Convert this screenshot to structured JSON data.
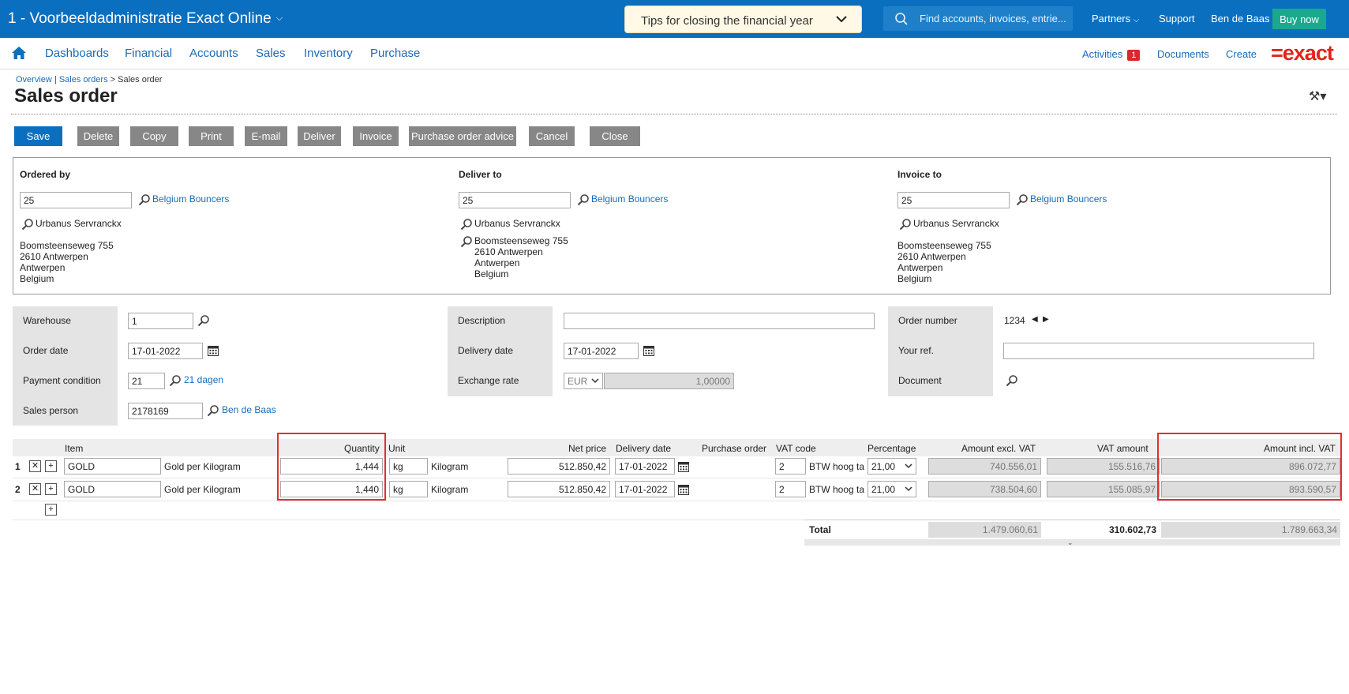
{
  "topbar": {
    "app_title": "1 - Voorbeeldadministratie Exact Online",
    "tips": "Tips for closing the financial year",
    "search_placeholder": "Find accounts, invoices, entrie...",
    "partners": "Partners",
    "support": "Support",
    "user": "Ben de Baas",
    "buy_now": "Buy now"
  },
  "menu": {
    "items": [
      "Dashboards",
      "Financial",
      "Accounts",
      "Sales",
      "Inventory",
      "Purchase"
    ],
    "activities": "Activities",
    "activities_count": "1",
    "documents": "Documents",
    "create": "Create",
    "logo": "=exact"
  },
  "breadcrumb": {
    "overview": "Overview",
    "sep1": "|",
    "sales_orders": "Sales orders",
    "sep2": ">",
    "current": "Sales order"
  },
  "page": {
    "title": "Sales order"
  },
  "toolbar": {
    "save": "Save",
    "delete": "Delete",
    "copy": "Copy",
    "print": "Print",
    "email": "E-mail",
    "deliver": "Deliver",
    "invoice": "Invoice",
    "purchase_order_advice": "Purchase order advice",
    "cancel": "Cancel",
    "close": "Close"
  },
  "parties": [
    {
      "title": "Ordered by",
      "code": "25",
      "name": "Belgium Bouncers",
      "contact": "Urbanus Servranckx",
      "address": [
        "Boomsteenseweg 755",
        "2610 Antwerpen",
        "Antwerpen",
        "Belgium"
      ]
    },
    {
      "title": "Deliver to",
      "code": "25",
      "name": "Belgium Bouncers",
      "contact": "Urbanus Servranckx",
      "address": [
        "Boomsteenseweg 755",
        "2610 Antwerpen",
        "Antwerpen",
        "Belgium"
      ]
    },
    {
      "title": "Invoice to",
      "code": "25",
      "name": "Belgium Bouncers",
      "contact": "Urbanus Servranckx",
      "address": [
        "Boomsteenseweg 755",
        "2610 Antwerpen",
        "Antwerpen",
        "Belgium"
      ]
    }
  ],
  "header_fields": {
    "warehouse_label": "Warehouse",
    "warehouse": "1",
    "order_date_label": "Order date",
    "order_date": "17-01-2022",
    "payment_condition_label": "Payment condition",
    "payment_condition": "21",
    "payment_condition_desc": "21 dagen",
    "sales_person_label": "Sales person",
    "sales_person": "2178169",
    "sales_person_name": "Ben de Baas",
    "description_label": "Description",
    "description": "",
    "delivery_date_label": "Delivery date",
    "delivery_date": "17-01-2022",
    "exchange_rate_label": "Exchange rate",
    "currency": "EUR",
    "exchange_rate": "1,00000",
    "order_number_label": "Order number",
    "order_number": "1234",
    "your_ref_label": "Your ref.",
    "your_ref": "",
    "document_label": "Document"
  },
  "lines": {
    "columns": {
      "item": "Item",
      "quantity": "Quantity",
      "unit": "Unit",
      "net_price": "Net price",
      "delivery_date": "Delivery date",
      "purchase_order": "Purchase order",
      "vat_code": "VAT code",
      "percentage": "Percentage",
      "amount_excl": "Amount excl. VAT",
      "vat_amount": "VAT amount",
      "amount_incl": "Amount incl. VAT"
    },
    "rows": [
      {
        "num": "1",
        "item": "GOLD",
        "item_desc": "Gold per Kilogram",
        "quantity": "1,444",
        "unit": "kg",
        "unit_desc": "Kilogram",
        "net_price": "512.850,42",
        "delivery_date": "17-01-2022",
        "vat_code": "2",
        "vat_desc": "BTW hoog ta",
        "percentage": "21,00",
        "amount_excl": "740.556,01",
        "vat_amount": "155.516,76",
        "amount_incl": "896.072,77"
      },
      {
        "num": "2",
        "item": "GOLD",
        "item_desc": "Gold per Kilogram",
        "quantity": "1,440",
        "unit": "kg",
        "unit_desc": "Kilogram",
        "net_price": "512.850,42",
        "delivery_date": "17-01-2022",
        "vat_code": "2",
        "vat_desc": "BTW hoog ta",
        "percentage": "21,00",
        "amount_excl": "738.504,60",
        "vat_amount": "155.085,97",
        "amount_incl": "893.590,57"
      }
    ]
  },
  "totals": {
    "label": "Total",
    "amount_excl": "1.479.060,61",
    "vat_amount": "310.602,73",
    "amount_incl": "1.789.663,34"
  },
  "icons": {
    "remove_line": "✕",
    "add_line": "+",
    "prev": "◀",
    "next": "▶"
  }
}
